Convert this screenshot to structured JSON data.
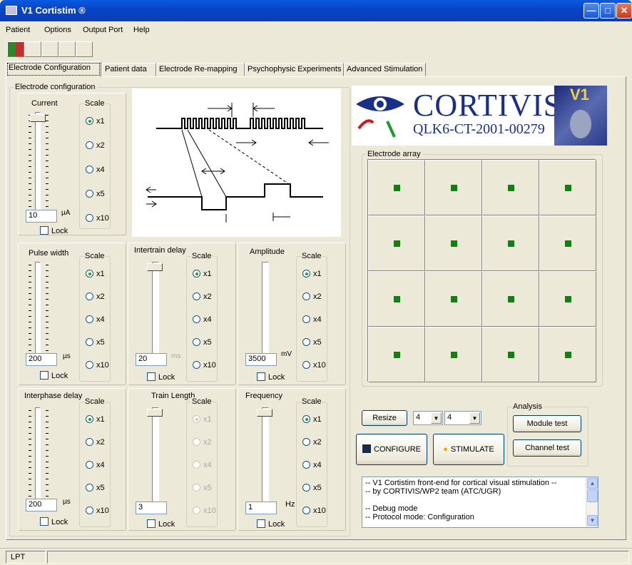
{
  "window": {
    "title": "V1 Cortistim ®"
  },
  "menu": [
    "Patient",
    "Options",
    "Output Port",
    "Help"
  ],
  "tabs": [
    "Electrode Configuration",
    "Patient data",
    "Electrode Re-mapping",
    "Psychophysic Experiments",
    "Advanced Stimulation"
  ],
  "config": {
    "group_label": "Electrode configuration",
    "scale_label": "Scale",
    "scale_options": [
      "x1",
      "x2",
      "x4",
      "x5",
      "x10"
    ],
    "lock_label": "Lock",
    "panels": {
      "current": {
        "title": "Current",
        "value": "10",
        "unit": "µA",
        "selected": "x1"
      },
      "pulse_width": {
        "title": "Pulse width",
        "value": "200",
        "unit": "µs",
        "selected": "x1"
      },
      "intertrain_delay": {
        "title": "Intertrain delay",
        "value": "20",
        "unit": "ms",
        "selected": "x1"
      },
      "amplitude": {
        "title": "Amplitude",
        "value": "3500",
        "unit": "mV",
        "selected": "x1"
      },
      "interphase_delay": {
        "title": "Interphase delay",
        "value": "200",
        "unit": "µs",
        "selected": "x1"
      },
      "train_length": {
        "title": "Train Length",
        "value": "3",
        "unit": "",
        "selected": "x1",
        "disabled": true
      },
      "frequency": {
        "title": "Frequency",
        "value": "1",
        "unit": "Hz",
        "selected": "x1"
      }
    }
  },
  "logo": {
    "brand": "CORTIVIS",
    "code": "QLK6-CT-2001-00279",
    "badge": "V1"
  },
  "electrode_array": {
    "label": "Electrode array",
    "rows": 4,
    "cols": 4,
    "active_color": "#108010"
  },
  "controls": {
    "resize_label": "Resize",
    "rows_value": "4",
    "cols_value": "4",
    "configure_label": "CONFIGURE",
    "stimulate_label": "STIMULATE",
    "analysis_label": "Analysis",
    "module_test_label": "Module test",
    "channel_test_label": "Channel test"
  },
  "log": {
    "lines": [
      "-- V1 Cortistim front-end for cortical visual stimulation --",
      "-- by CORTIVIS/WP2 team (ATC/UGR)",
      "",
      "-- Debug mode",
      "-- Protocol mode: Configuration"
    ]
  },
  "status": {
    "port": "LPT"
  }
}
